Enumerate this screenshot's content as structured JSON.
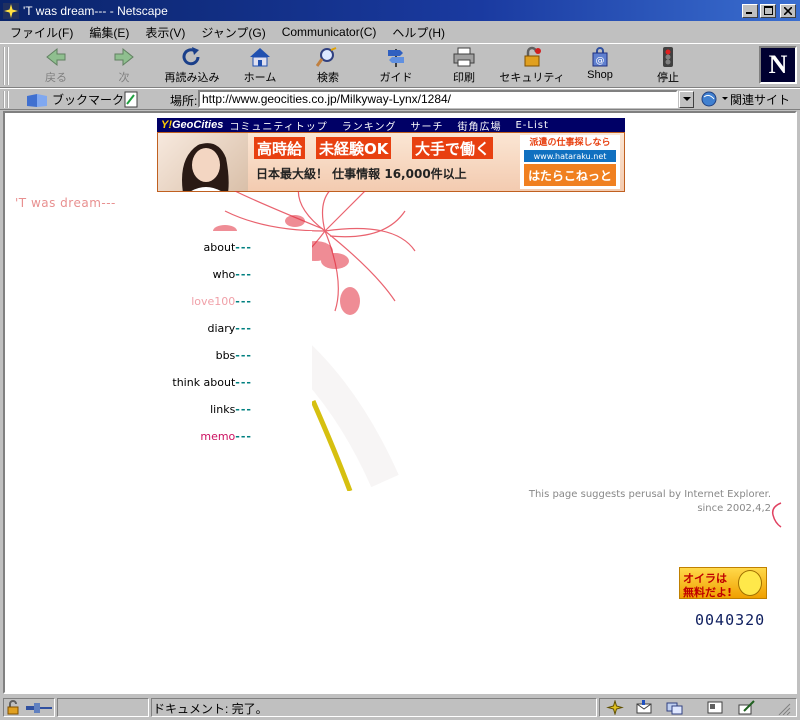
{
  "window": {
    "title": "'T was dream--- - Netscape"
  },
  "menu": [
    "ファイル(F)",
    "編集(E)",
    "表示(V)",
    "ジャンプ(G)",
    "Communicator(C)",
    "ヘルプ(H)"
  ],
  "toolbar": {
    "back": "戻る",
    "forward": "次",
    "reload": "再読み込み",
    "home": "ホーム",
    "search": "検索",
    "guide": "ガイド",
    "print": "印刷",
    "security": "セキュリティ",
    "shop": "Shop",
    "stop": "停止",
    "logo": "N"
  },
  "location": {
    "bookmarks_label": "ブックマーク",
    "location_label": "場所:",
    "url": "http://www.geocities.co.jp/Milkyway-Lynx/1284/",
    "related_label": "関連サイト"
  },
  "geocities": {
    "logo_a": "Y!",
    "logo_b": "GeoCities",
    "nav": [
      "コミュニティトップ",
      "ランキング",
      "サーチ",
      "街角広場",
      "E-List"
    ]
  },
  "banner": {
    "tag1": "高時給",
    "tag2": "未経験OK",
    "tag3": "大手で働く",
    "line2": "日本最大級！ 仕事情報 16,000件以上",
    "side1": "派遣の仕事探しなら",
    "side2": "www.hataraku.net",
    "side3": "はたらこねっと"
  },
  "page": {
    "site_title": "'T was dream---",
    "nav_dash": "---",
    "nav": [
      {
        "label": "about",
        "color": "#000000"
      },
      {
        "label": "who",
        "color": "#000000"
      },
      {
        "label": "love100",
        "color": "#f0a0a8"
      },
      {
        "label": "diary",
        "color": "#000000"
      },
      {
        "label": "bbs",
        "color": "#000000"
      },
      {
        "label": "think about",
        "color": "#000000"
      },
      {
        "label": "links",
        "color": "#000000"
      },
      {
        "label": "memo",
        "color": "#cc1060"
      }
    ],
    "note1": "This page suggests perusal by Internet Explorer.",
    "note2": "since 2002,4,2",
    "badge1": "オイラは",
    "badge2": "無料だよ!",
    "counter": "0040320"
  },
  "status": {
    "text": "ドキュメント: 完了。"
  }
}
